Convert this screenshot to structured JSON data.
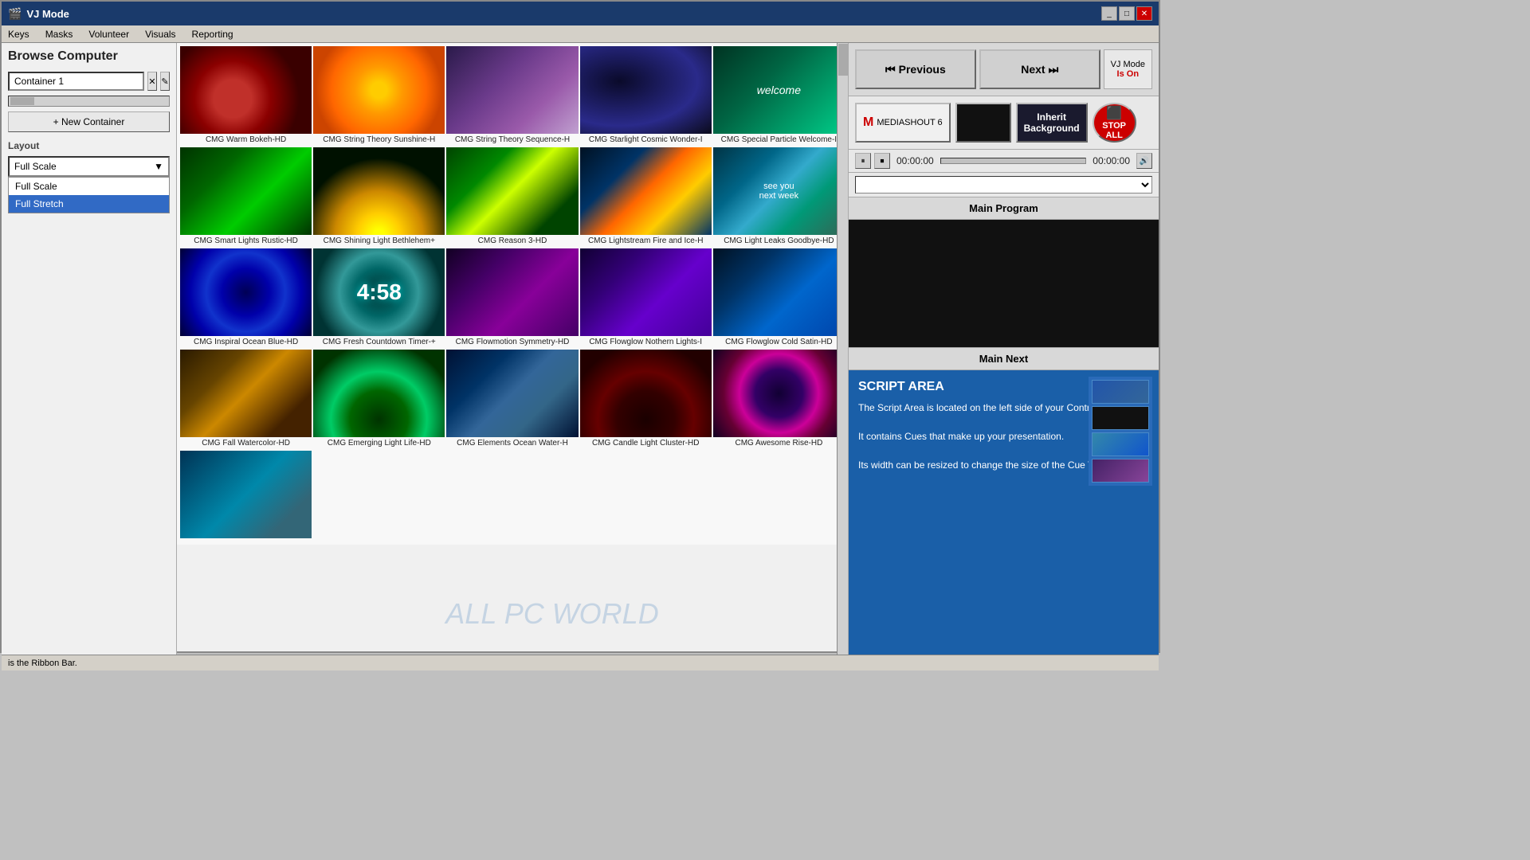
{
  "window": {
    "title": "VJ Mode",
    "controls": [
      "minimize",
      "maximize",
      "close"
    ]
  },
  "menu": {
    "items": [
      "Keys",
      "Masks",
      "Volunteer",
      "Visuals",
      "Reporting"
    ]
  },
  "left_panel": {
    "browse_title": "Browse Computer",
    "container_value": "Container 1",
    "new_container_label": "+ New Container",
    "layout_label": "Layout",
    "layout_current": "Full Scale",
    "layout_options": [
      "Full Scale",
      "Full Stretch"
    ]
  },
  "grid": {
    "items": [
      {
        "label": "CMG Warm Bokeh-HD",
        "thumb_class": "thumb-bokeh"
      },
      {
        "label": "CMG String Theory Sunshine-H",
        "thumb_class": "thumb-sunshine"
      },
      {
        "label": "CMG String Theory Sequence-H",
        "thumb_class": "thumb-sequence"
      },
      {
        "label": "CMG Starlight Cosmic Wonder-I",
        "thumb_class": "thumb-cosmic"
      },
      {
        "label": "CMG Special Particle Welcome-I",
        "thumb_class": "thumb-particle"
      },
      {
        "label": "CMG Smart Lights Rustic-HD",
        "thumb_class": "thumb-smart"
      },
      {
        "label": "CMG Shining Light Bethlehem+",
        "thumb_class": "thumb-bethlehem"
      },
      {
        "label": "CMG Reason 3-HD",
        "thumb_class": "thumb-reason"
      },
      {
        "label": "CMG Lightstream Fire and Ice-H",
        "thumb_class": "thumb-lightstream"
      },
      {
        "label": "CMG Light Leaks Goodbye-HD",
        "thumb_class": "thumb-goodbye"
      },
      {
        "label": "CMG Inspiral Ocean Blue-HD",
        "thumb_class": "thumb-ocean"
      },
      {
        "label": "CMG Fresh Countdown Timer-+",
        "thumb_class": "thumb-countdown"
      },
      {
        "label": "CMG Flowmotion Symmetry-HD",
        "thumb_class": "thumb-flowmotion"
      },
      {
        "label": "CMG Flowglow Nothern Lights-I",
        "thumb_class": "thumb-nothern"
      },
      {
        "label": "CMG Flowglow Cold Satin-HD",
        "thumb_class": "thumb-cold-satin"
      },
      {
        "label": "CMG Fall Watercolor-HD",
        "thumb_class": "thumb-watercolor"
      },
      {
        "label": "CMG Emerging Light Life-HD",
        "thumb_class": "thumb-emerging"
      },
      {
        "label": "CMG Elements Ocean Water-H",
        "thumb_class": "thumb-elements"
      },
      {
        "label": "CMG Candle Light Cluster-HD",
        "thumb_class": "thumb-candle"
      },
      {
        "label": "CMG Awesome Rise-HD",
        "thumb_class": "thumb-awesome"
      },
      {
        "label": "",
        "thumb_class": "thumb-last"
      }
    ]
  },
  "right_panel": {
    "previous_label": "Previous",
    "next_label": "Next",
    "vj_mode_label": "VJ Mode",
    "vj_mode_status": "Is On",
    "media_shout_label": "MEDIASHOUT 6",
    "inherit_bg_label": "Inherit Background",
    "stop_all_label": "STOP ALL",
    "time_start": "00:00:00",
    "time_end": "00:00:00",
    "main_program_label": "Main Program",
    "main_next_label": "Main Next",
    "script_area": {
      "title": "SCRIPT AREA",
      "line1": "The Script Area is located on the left side of your Control Screen.",
      "line2": "It contains Cues that make up your presentation.",
      "line3": "Its width can be resized to change the size of the Cue Thumbnails."
    }
  },
  "watermark": "ALL PC WORLD",
  "status_bar": "is the Ribbon Bar."
}
